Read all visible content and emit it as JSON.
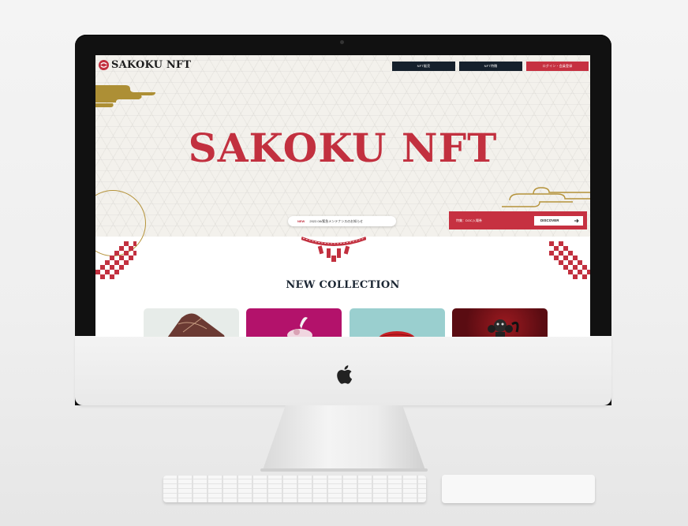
{
  "site": {
    "logo_text": "SAKOKU NFT",
    "nav": [
      {
        "label": "NFT販売"
      },
      {
        "label": "NFT特徴"
      },
      {
        "label": "ログイン・会員登録"
      }
    ],
    "hero_title": "SAKOKU NFT",
    "news": {
      "tag": "NEW",
      "text": "2022.08•緊急メンテナンスのお知らせ"
    },
    "discover": {
      "text": "特集：DOC入場券",
      "button_label": "DISCOVER"
    },
    "section_title": "NEW COLLECTION",
    "collection_cards": [
      {
        "bg": "#e7ece9"
      },
      {
        "bg": "#b3126b"
      },
      {
        "bg": "#9acfcf"
      },
      {
        "bg": "#7b1219"
      }
    ]
  },
  "colors": {
    "brand_red": "#c2303f",
    "navy": "#15202c",
    "gold": "#b5933a",
    "hero_bg": "#f3f1ec"
  },
  "icons": [
    "apple-icon",
    "logo-mark-icon",
    "arrow-right-icon"
  ]
}
